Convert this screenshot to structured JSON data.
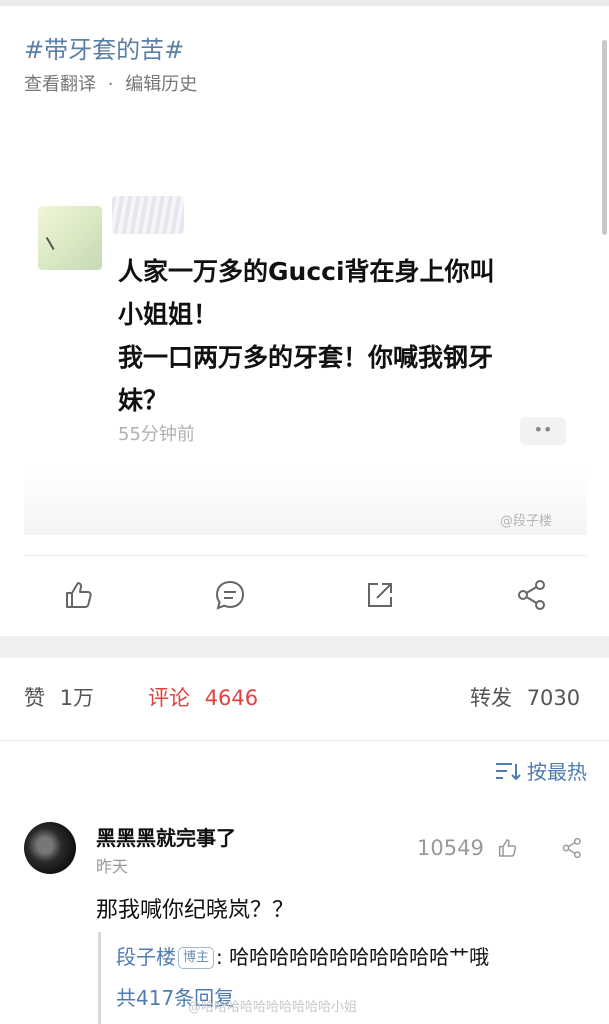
{
  "header": {
    "topic": "#带牙套的苦#",
    "translate_link": "查看翻译",
    "separator": "·",
    "history_link": "编辑历史"
  },
  "post": {
    "text_line1": "人家一万多的Gucci背在身上你叫",
    "text_line2": "小姐姐！",
    "text_line3": "我一口两万多的牙套！你喊我钢牙",
    "text_line4": "妹？",
    "time": "55分钟前",
    "more_label": "••",
    "watermark": "@段子楼"
  },
  "actions": {
    "like_icon": "thumb-up-icon",
    "comment_icon": "comment-icon",
    "repost_icon": "share-out-icon",
    "share_icon": "share-nodes-icon"
  },
  "stats": {
    "likes_label": "赞",
    "likes_count": "1万",
    "comments_label": "评论",
    "comments_count": "4646",
    "reposts_label": "转发",
    "reposts_count": "7030",
    "accent": "#e2413e"
  },
  "sort": {
    "icon": "sort-icon",
    "label": "按最热"
  },
  "comment": {
    "author": "黑黑黑就完事了",
    "time": "昨天",
    "likes": "10549",
    "text": "那我喊你纪晓岚？？",
    "reply_author": "段子楼",
    "reply_badge": "博主",
    "reply_text": ": 哈哈哈哈哈哈哈哈哈哈哈艹哦",
    "reply_more": "共417条回复",
    "bottom_watermark": "@哈哈哈哈哈哈哈哈哈哈小姐"
  }
}
